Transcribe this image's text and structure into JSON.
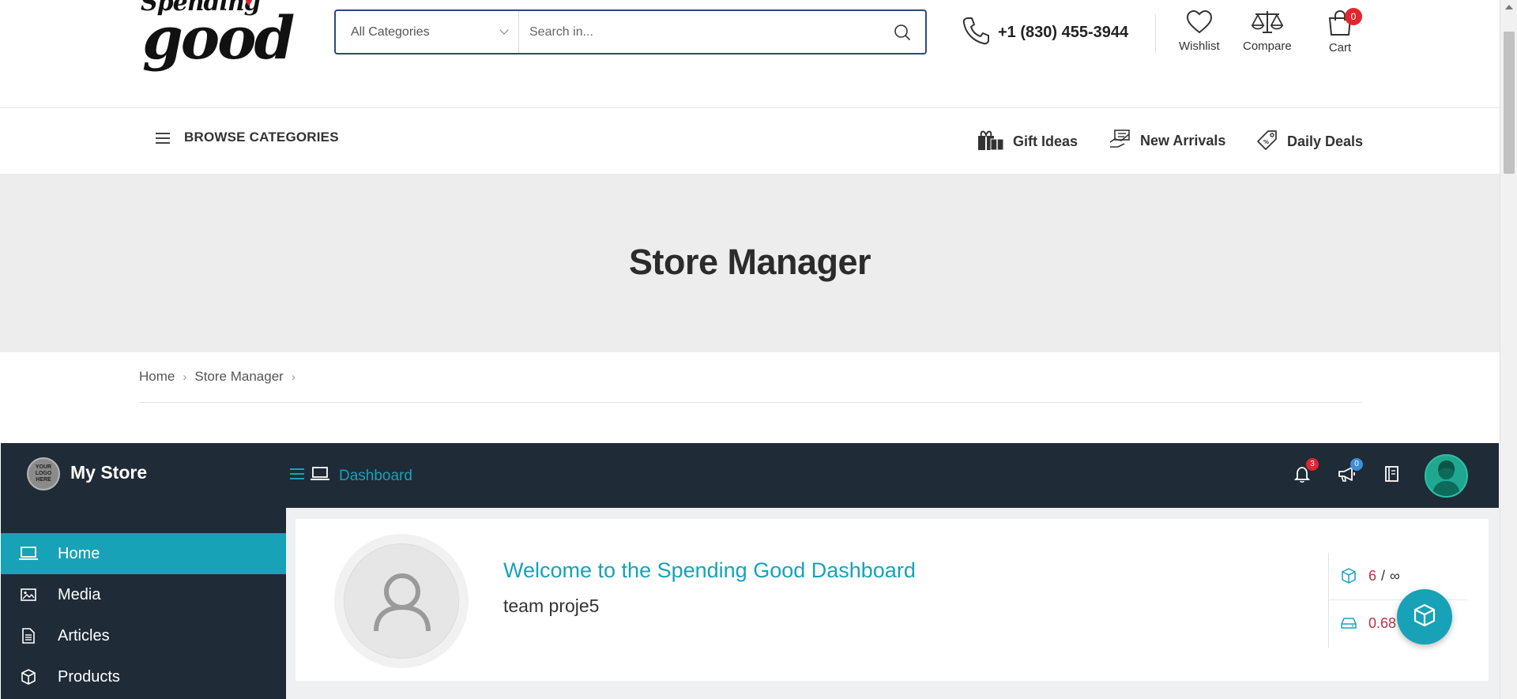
{
  "header": {
    "logo": {
      "line1": "Spending",
      "line2": "good"
    },
    "search": {
      "category": "All Categories",
      "placeholder": "Search in..."
    },
    "phone": "+1 (830) 455-3944",
    "actions": {
      "wishlist": "Wishlist",
      "compare": "Compare",
      "cart": "Cart",
      "cart_count": "0"
    }
  },
  "nav": {
    "browse": "BROWSE CATEGORIES",
    "links": {
      "gift_ideas": "Gift Ideas",
      "new_arrivals": "New Arrivals",
      "daily_deals": "Daily Deals"
    }
  },
  "page": {
    "title": "Store Manager",
    "breadcrumb": {
      "home": "Home",
      "current": "Store Manager"
    }
  },
  "dashboard": {
    "store_logo_text": "YOUR LOGO HERE",
    "store_name": "My Store",
    "section": "Dashboard",
    "notifications_count": "3",
    "announcements_count": "0",
    "sidebar": {
      "home": "Home",
      "media": "Media",
      "articles": "Articles",
      "products": "Products"
    },
    "welcome_title": "Welcome to the Spending Good Dashboard",
    "welcome_user": "team proje5",
    "stats": {
      "products_used": "6",
      "products_limit": "∞",
      "space_used": "0.68"
    }
  },
  "colors": {
    "accent": "#17a2b8",
    "dark": "#1f2b37",
    "badge_red": "#e0262f",
    "search_border": "#2c4a77"
  }
}
